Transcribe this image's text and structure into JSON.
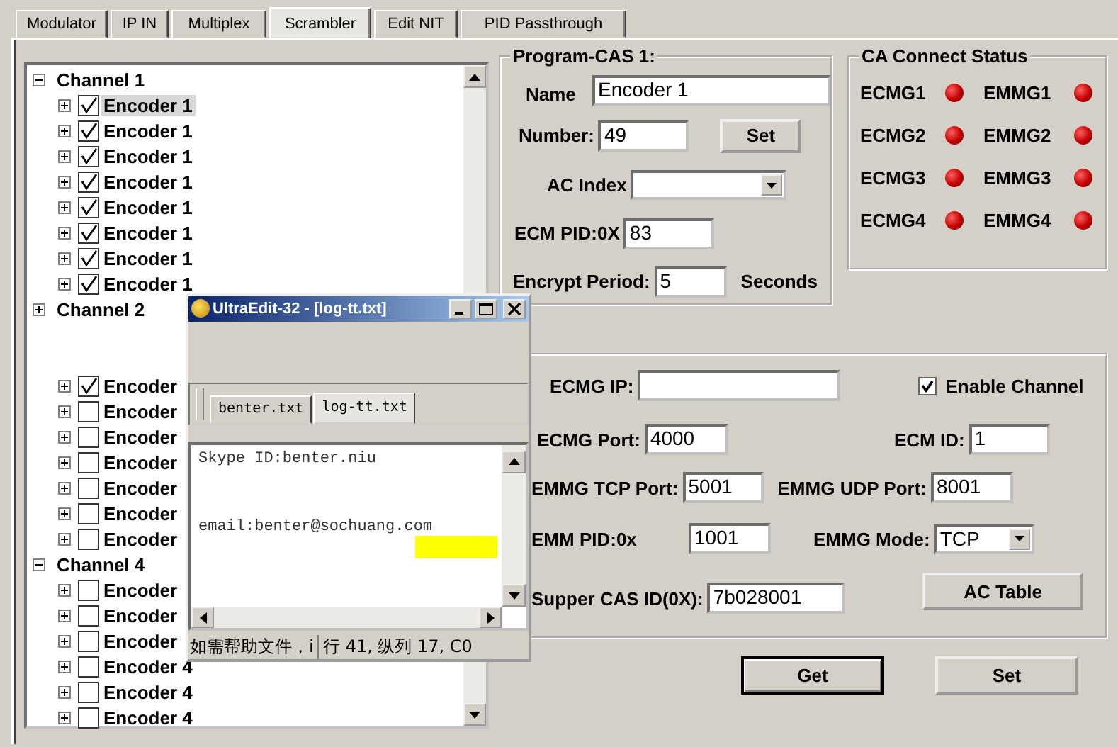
{
  "tabs": [
    {
      "label": "Modulator",
      "selected": false
    },
    {
      "label": "IP IN",
      "selected": false
    },
    {
      "label": "Multiplex",
      "selected": false
    },
    {
      "label": "Scrambler",
      "selected": true
    },
    {
      "label": "Edit NIT",
      "selected": false
    },
    {
      "label": "PID Passthrough",
      "selected": false
    }
  ],
  "tree": {
    "channels": [
      {
        "label": "Channel 1",
        "expanded": true,
        "items": [
          {
            "label": "Encoder 1",
            "checked": true,
            "selected": true
          },
          {
            "label": "Encoder 1",
            "checked": true,
            "selected": false
          },
          {
            "label": "Encoder 1",
            "checked": true,
            "selected": false
          },
          {
            "label": "Encoder 1",
            "checked": true,
            "selected": false
          },
          {
            "label": "Encoder 1",
            "checked": true,
            "selected": false
          },
          {
            "label": "Encoder 1",
            "checked": true,
            "selected": false
          },
          {
            "label": "Encoder 1",
            "checked": true,
            "selected": false
          },
          {
            "label": "Encoder 1",
            "checked": true,
            "selected": false
          }
        ]
      },
      {
        "label": "Channel 2",
        "expanded": false
      },
      {
        "obscured": true,
        "expanded": true,
        "items": [
          {
            "obscured": true
          },
          {
            "label": "Encoder",
            "checked": true,
            "selected": false
          },
          {
            "label": "Encoder",
            "checked": false,
            "selected": false
          },
          {
            "label": "Encoder",
            "checked": false,
            "selected": false
          },
          {
            "label": "Encoder",
            "checked": false,
            "selected": false
          },
          {
            "label": "Encoder",
            "checked": false,
            "selected": false
          },
          {
            "label": "Encoder",
            "checked": false,
            "selected": false
          },
          {
            "label": "Encoder",
            "checked": false,
            "selected": false
          }
        ]
      },
      {
        "label": "Channel 4",
        "expanded": true,
        "items": [
          {
            "label": "Encoder",
            "checked": false,
            "selected": false
          },
          {
            "label": "Encoder",
            "checked": false,
            "selected": false
          },
          {
            "label": "Encoder",
            "checked": false,
            "selected": false
          },
          {
            "label": "Encoder 4",
            "checked": false,
            "selected": false
          },
          {
            "label": "Encoder 4",
            "checked": false,
            "selected": false
          },
          {
            "label": "Encoder 4",
            "checked": false,
            "selected": false
          }
        ]
      }
    ]
  },
  "program_cas": {
    "title": "Program-CAS 1:",
    "name_label": "Name",
    "name_value": "Encoder 1",
    "number_label": "Number:",
    "number_value": "49",
    "set_button": "Set",
    "ac_index_label": "AC Index",
    "ecm_pid_label": "ECM PID:0X",
    "ecm_pid_value": "83",
    "period_label": "Encrypt Period:",
    "period_value": "5",
    "period_unit": "Seconds"
  },
  "ca_status": {
    "title": "CA Connect Status",
    "items": [
      {
        "label": "ECMG1",
        "connected": false
      },
      {
        "label": "EMMG1",
        "connected": false
      },
      {
        "label": "ECMG2",
        "connected": false
      },
      {
        "label": "EMMG2",
        "connected": false
      },
      {
        "label": "ECMG3",
        "connected": false
      },
      {
        "label": "EMMG3",
        "connected": false
      },
      {
        "label": "ECMG4",
        "connected": false
      },
      {
        "label": "EMMG4",
        "connected": false
      }
    ]
  },
  "ecmg": {
    "ip_label": "ECMG IP:",
    "enable_channel": {
      "label": "Enable Channel",
      "checked": true
    },
    "port_label": "ECMG Port:",
    "port_value": "4000",
    "ecm_id_label": "ECM ID:",
    "ecm_id_value": "1",
    "tcp_label": "EMMG TCP Port:",
    "tcp_value": "5001",
    "udp_label": "EMMG UDP Port:",
    "udp_value": "8001",
    "emm_pid_label": "EMM PID:0x",
    "emm_pid_value": "1001",
    "mode_label": "EMMG Mode:",
    "mode_value": "TCP",
    "cas_id_label": "Supper CAS ID(0X):",
    "cas_id_value": "7b028001",
    "ac_table_button": "AC Table"
  },
  "buttons": [
    "Get",
    "Set"
  ],
  "editor": {
    "title": "UltraEdit-32 - [log-tt.txt]",
    "tabs": [
      {
        "label": "benter.txt",
        "selected": false
      },
      {
        "label": "log-tt.txt",
        "selected": true
      }
    ],
    "lines": [
      {
        "text": "Skype ID:benter.niu"
      },
      {
        "text": "email:benter@sochuang.com"
      }
    ],
    "status_help": "如需帮助文件，i",
    "status_position": "行 41, 纵列 17, C0"
  }
}
